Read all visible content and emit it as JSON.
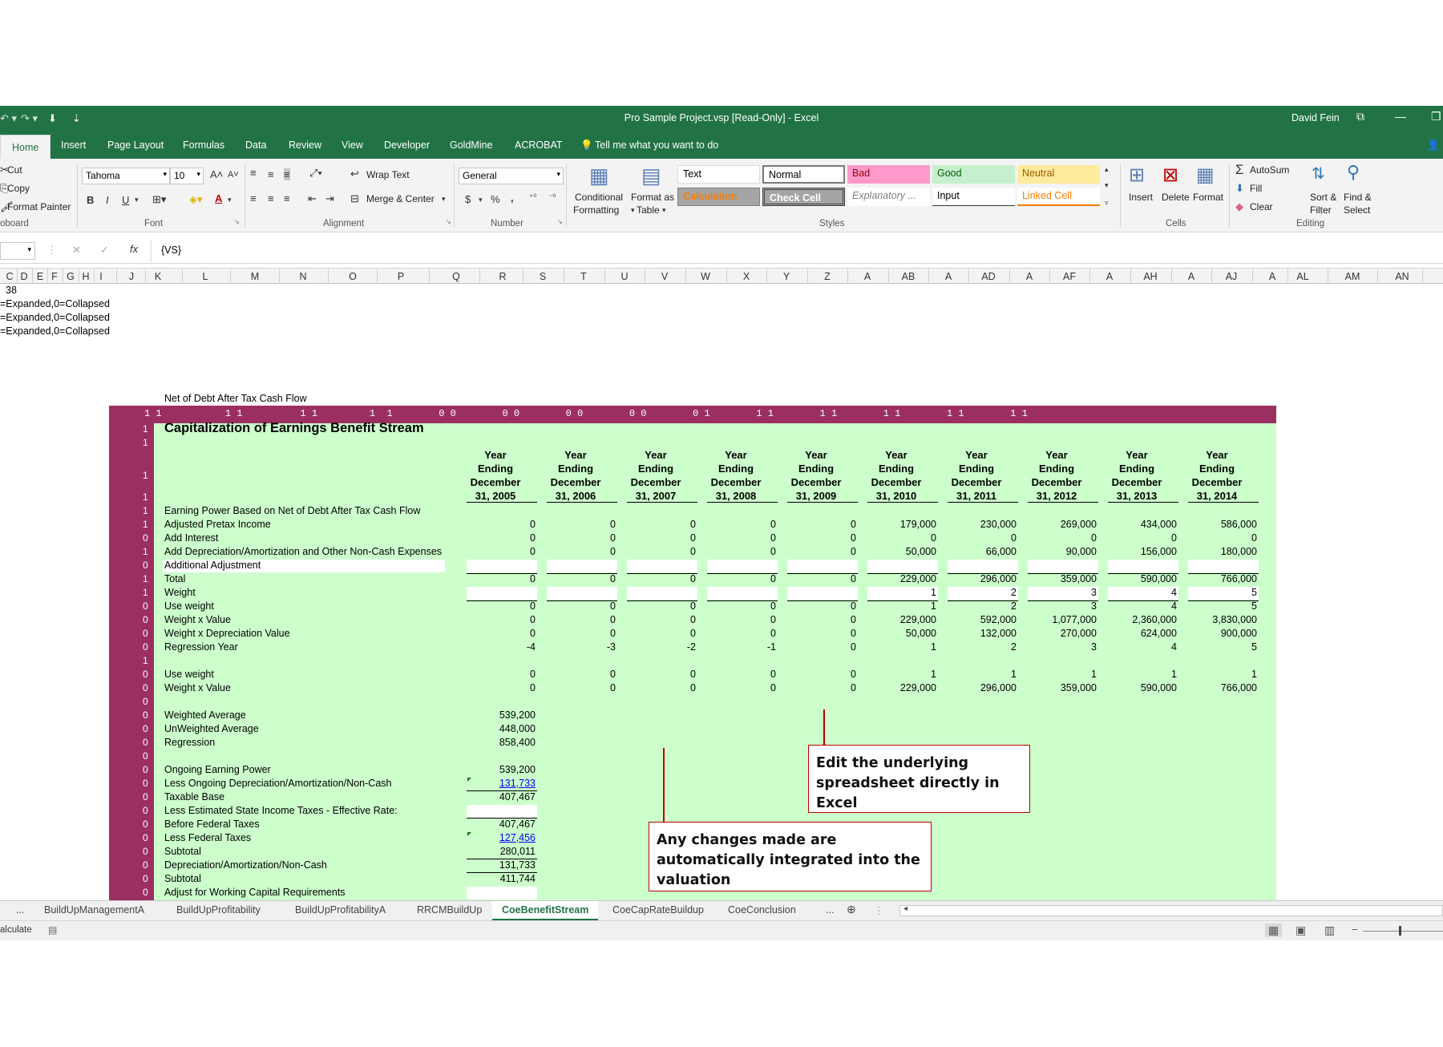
{
  "window": {
    "title": "Pro Sample Project.vsp  [Read-Only] - Excel",
    "user": "David Fein"
  },
  "ribbon_tabs": [
    "Home",
    "Insert",
    "Page Layout",
    "Formulas",
    "Data",
    "Review",
    "View",
    "Developer",
    "GoldMine",
    "ACROBAT"
  ],
  "tell_me": "Tell me what you want to do",
  "clipboard": {
    "cut": "Cut",
    "copy": "Copy",
    "format_painter": "Format Painter",
    "group": "oboard"
  },
  "font": {
    "name": "Tahoma",
    "size": "10",
    "bold": "B",
    "italic": "I",
    "underline": "U",
    "group": "Font"
  },
  "alignment": {
    "wrap_text": "Wrap Text",
    "merge_center": "Merge & Center",
    "group": "Alignment"
  },
  "number": {
    "format": "General",
    "currency": "$",
    "percent": "%",
    "comma": ",",
    "group": "Number"
  },
  "styles": {
    "conditional_line1": "Conditional",
    "conditional_line2": "Formatting",
    "format_table_line1": "Format as",
    "format_table_line2": "Table",
    "cells": [
      "Text",
      "Normal",
      "Bad",
      "Good",
      "Neutral",
      "Calculation",
      "Check Cell",
      "Explanatory ...",
      "Input",
      "Linked Cell"
    ],
    "group": "Styles"
  },
  "cells_group": {
    "insert": "Insert",
    "delete": "Delete",
    "format": "Format",
    "group": "Cells"
  },
  "editing": {
    "autosum": "AutoSum",
    "fill": "Fill",
    "clear": "Clear",
    "sort_line1": "Sort &",
    "sort_line2": "Filter",
    "find_line1": "Find &",
    "find_line2": "Select",
    "group": "Editing"
  },
  "formula_bar": {
    "fx": "fx",
    "value": "{VS}"
  },
  "columns": [
    "C",
    "D",
    "E",
    "F",
    "G",
    "H",
    "I",
    "J",
    "K",
    "L",
    "M",
    "N",
    "O",
    "P",
    "Q",
    "R",
    "S",
    "T",
    "U",
    "V",
    "W",
    "X",
    "Y",
    "Z",
    "A",
    "AB",
    "A",
    "AD",
    "A",
    "AF",
    "A",
    "AH",
    "A",
    "AJ",
    "A",
    "AL",
    "AM",
    "AN"
  ],
  "top_rows": [
    "38",
    "=Expanded,0=Collapsed",
    "=Expanded,0=Collapsed",
    "=Expanded,0=Collapsed"
  ],
  "sheet": {
    "label_above": "Net of Debt After Tax Cash Flow",
    "maroon_row": "1 1           1 1          1 1         1  1        0 0        0 0        0 0        0 0        0 1        1 1        1 1        1 1        1 1        1 1",
    "title": "Capitalization of Earnings Benefit Stream",
    "row_flags": [
      "1",
      "1",
      "1",
      "1",
      "1",
      "1",
      "0",
      "1",
      "0",
      "1",
      "1",
      "0",
      "0",
      "0",
      "0",
      "1",
      "0",
      "0",
      "0",
      "0",
      "0",
      "0",
      "0",
      "0",
      "0",
      "0",
      "0",
      "0",
      "0",
      "0",
      "0",
      "0",
      "0",
      "0",
      "0"
    ],
    "years": [
      "Year Ending December 31, 2005",
      "Year Ending December 31, 2006",
      "Year Ending December 31, 2007",
      "Year Ending December 31, 2008",
      "Year Ending December 31, 2009",
      "Year Ending December 31, 2010",
      "Year Ending December 31, 2011",
      "Year Ending December 31, 2012",
      "Year Ending December 31, 2013",
      "Year Ending December 31, 2014"
    ],
    "year_lines": [
      [
        "Year",
        "Ending",
        "December",
        "31, 2005"
      ],
      [
        "Year",
        "Ending",
        "December",
        "31, 2006"
      ],
      [
        "Year",
        "Ending",
        "December",
        "31, 2007"
      ],
      [
        "Year",
        "Ending",
        "December",
        "31, 2008"
      ],
      [
        "Year",
        "Ending",
        "December",
        "31, 2009"
      ],
      [
        "Year",
        "Ending",
        "December",
        "31, 2010"
      ],
      [
        "Year",
        "Ending",
        "December",
        "31, 2011"
      ],
      [
        "Year",
        "Ending",
        "December",
        "31, 2012"
      ],
      [
        "Year",
        "Ending",
        "December",
        "31, 2013"
      ],
      [
        "Year",
        "Ending",
        "December",
        "31, 2014"
      ]
    ],
    "section_label": "Earning Power Based on Net of Debt After Tax Cash Flow",
    "rows": [
      {
        "label": "Adjusted Pretax Income",
        "values": [
          "0",
          "0",
          "0",
          "0",
          "0",
          "179,000",
          "230,000",
          "269,000",
          "434,000",
          "586,000"
        ]
      },
      {
        "label": "Add Interest",
        "values": [
          "0",
          "0",
          "0",
          "0",
          "0",
          "0",
          "0",
          "0",
          "0",
          "0"
        ]
      },
      {
        "label": "Add Depreciation/Amortization and Other Non-Cash Expenses",
        "values": [
          "0",
          "0",
          "0",
          "0",
          "0",
          "50,000",
          "66,000",
          "90,000",
          "156,000",
          "180,000"
        ]
      },
      {
        "label": "Additional Adjustment",
        "values": [
          "",
          "",
          "",
          "",
          "",
          "",
          "",
          "",
          "",
          ""
        ]
      },
      {
        "label": "Total",
        "values": [
          "0",
          "0",
          "0",
          "0",
          "0",
          "229,000",
          "296,000",
          "359,000",
          "590,000",
          "766,000"
        ]
      },
      {
        "label": "Weight",
        "values": [
          "",
          "",
          "",
          "",
          "",
          "1",
          "2",
          "3",
          "4",
          "5"
        ]
      },
      {
        "label": "Use weight",
        "values": [
          "0",
          "0",
          "0",
          "0",
          "0",
          "1",
          "2",
          "3",
          "4",
          "5"
        ]
      },
      {
        "label": "Weight x Value",
        "values": [
          "0",
          "0",
          "0",
          "0",
          "0",
          "229,000",
          "592,000",
          "1,077,000",
          "2,360,000",
          "3,830,000"
        ]
      },
      {
        "label": "Weight x Depreciation Value",
        "values": [
          "0",
          "0",
          "0",
          "0",
          "0",
          "50,000",
          "132,000",
          "270,000",
          "624,000",
          "900,000"
        ]
      },
      {
        "label": "Regression Year",
        "values": [
          "-4",
          "-3",
          "-2",
          "-1",
          "0",
          "1",
          "2",
          "3",
          "4",
          "5"
        ]
      },
      {
        "label": "",
        "values": [
          "",
          "",
          "",
          "",
          "",
          "",
          "",
          "",
          "",
          ""
        ]
      },
      {
        "label": "Use weight",
        "values": [
          "0",
          "0",
          "0",
          "0",
          "0",
          "1",
          "1",
          "1",
          "1",
          "1"
        ]
      },
      {
        "label": "Weight x Value",
        "values": [
          "0",
          "0",
          "0",
          "0",
          "0",
          "229,000",
          "296,000",
          "359,000",
          "590,000",
          "766,000"
        ]
      }
    ],
    "summary": [
      {
        "label": "Weighted Average",
        "value": "539,200"
      },
      {
        "label": "UnWeighted Average",
        "value": "448,000"
      },
      {
        "label": "Regression",
        "value": "858,400"
      },
      {
        "label": "",
        "value": ""
      },
      {
        "label": "Ongoing Earning Power",
        "value": "539,200"
      },
      {
        "label": "Less Ongoing Depreciation/Amortization/Non-Cash",
        "value": "131,733"
      },
      {
        "label": "Taxable Base",
        "value": "407,467"
      },
      {
        "label": "Less Estimated State Income Taxes - Effective Rate:",
        "value": ""
      },
      {
        "label": "Before Federal Taxes",
        "value": "407,467"
      },
      {
        "label": "Less Federal Taxes",
        "value": "127,456"
      },
      {
        "label": "Subtotal",
        "value": "280,011"
      },
      {
        "label": "Depreciation/Amortization/Non-Cash",
        "value": "131,733"
      },
      {
        "label": "Subtotal",
        "value": "411,744"
      },
      {
        "label": "Adjust for Working Capital Requirements",
        "value": ""
      }
    ]
  },
  "callouts": {
    "edit": "Edit the underlying spreadsheet directly in Excel",
    "changes": "Any changes made are automatically integrated into the valuation"
  },
  "sheet_tabs": [
    "...",
    "BuildUpManagementA",
    "BuildUpProfitability",
    "BuildUpProfitabilityA",
    "RRCMBuildUp",
    "CoeBenefitStream",
    "CoeCapRateBuildup",
    "CoeConclusion",
    "..."
  ],
  "status": {
    "left": "alculate"
  },
  "colors": {
    "excel_green": "#217346",
    "maroon": "#9c2f62",
    "sheet_green": "#ccffcc",
    "callout_red": "#c00000",
    "link_blue": "#0000ff"
  }
}
